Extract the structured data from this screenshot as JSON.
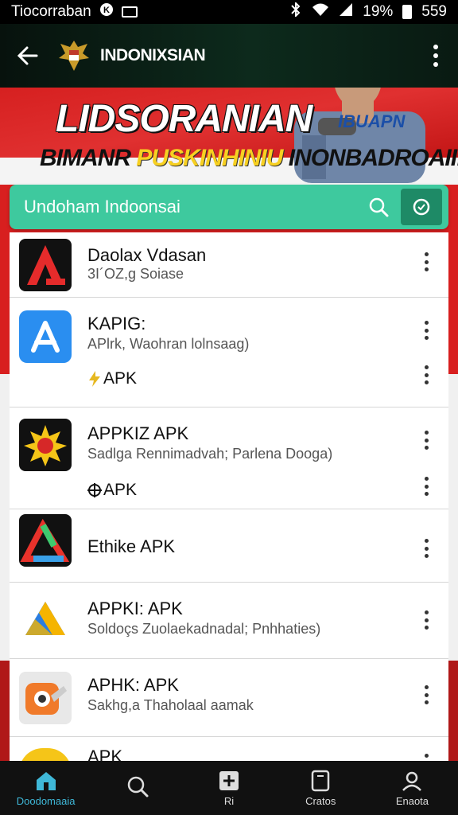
{
  "status_bar": {
    "app_name": "Tiocorraban",
    "battery": "19%",
    "time": "559"
  },
  "app_bar": {
    "title": "INDONIXSIAN"
  },
  "banner": {
    "title": "LIDSORANIAN",
    "subtitle_part1": "BIMANR",
    "subtitle_part2": "PUSKINHINIU",
    "subtitle_part3": "INONBADROAII!",
    "badge": "IBUAPN"
  },
  "search": {
    "text": "Undoham Indoonsai"
  },
  "apps": [
    {
      "title": "Daolax Vdasan",
      "subtitle": "3I´OZ,g Soiase",
      "tag": ""
    },
    {
      "title": "KAPIG:",
      "subtitle": "APlrk, Waohran lolnsaag)",
      "tag": "APK"
    },
    {
      "title": "APPKIZ APK",
      "subtitle": "Sadlga Rennimadvah; Parlena Dooga)",
      "tag": "APK"
    },
    {
      "title": "Ethike APK",
      "subtitle": "",
      "tag": ""
    },
    {
      "title": "APPKI: APK",
      "subtitle": "Soldoçs Zuolaekadnadal; Pnhhaties)",
      "tag": ""
    },
    {
      "title": "APHK: APK",
      "subtitle": "Sakhg,a Thaholaal aamak",
      "tag": ""
    },
    {
      "title": "APK",
      "subtitle": "",
      "tag": ""
    }
  ],
  "bottom_nav": [
    {
      "label": "Doodomaaia",
      "icon": "home-icon",
      "active": true
    },
    {
      "label": "",
      "icon": "search-icon",
      "active": false
    },
    {
      "label": "Ri",
      "icon": "add-box-icon",
      "active": false
    },
    {
      "label": "Cratos",
      "icon": "tablet-icon",
      "active": false
    },
    {
      "label": "Enaota",
      "icon": "profile-icon",
      "active": false
    }
  ],
  "colors": {
    "accent": "#3ec99e",
    "accent_dark": "#1e8a66",
    "banner_red": "#d62020",
    "active_nav": "#3fb8d8"
  }
}
